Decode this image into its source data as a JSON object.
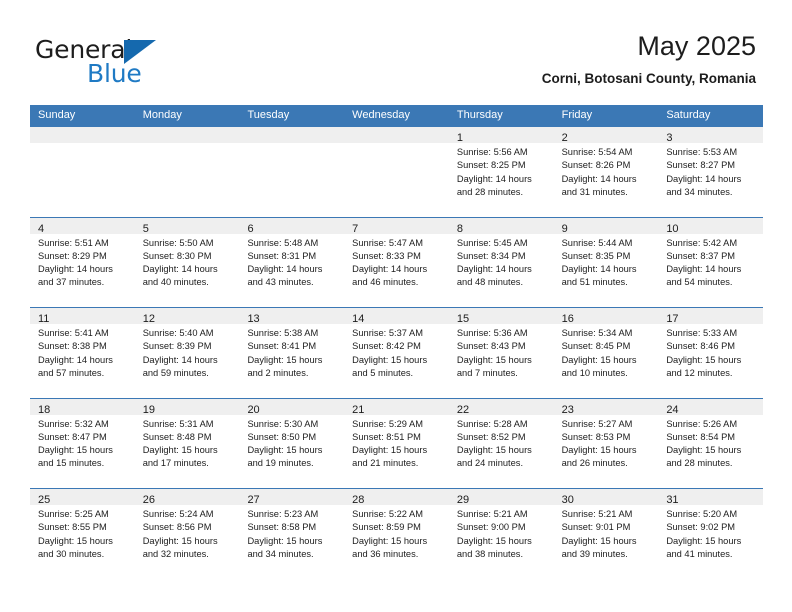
{
  "brand": {
    "name_part1": "General",
    "name_part2": "Blue",
    "accent_color": "#1f7ac4",
    "triangle_color": "#1569ae"
  },
  "header": {
    "month_title": "May 2025",
    "location": "Corni, Botosani County, Romania"
  },
  "calendar": {
    "header_bg": "#3b78b5",
    "weekdays": [
      "Sunday",
      "Monday",
      "Tuesday",
      "Wednesday",
      "Thursday",
      "Friday",
      "Saturday"
    ],
    "weeks": [
      [
        {
          "day": "",
          "lines": []
        },
        {
          "day": "",
          "lines": []
        },
        {
          "day": "",
          "lines": []
        },
        {
          "day": "",
          "lines": []
        },
        {
          "day": "1",
          "lines": [
            "Sunrise: 5:56 AM",
            "Sunset: 8:25 PM",
            "Daylight: 14 hours",
            "and 28 minutes."
          ]
        },
        {
          "day": "2",
          "lines": [
            "Sunrise: 5:54 AM",
            "Sunset: 8:26 PM",
            "Daylight: 14 hours",
            "and 31 minutes."
          ]
        },
        {
          "day": "3",
          "lines": [
            "Sunrise: 5:53 AM",
            "Sunset: 8:27 PM",
            "Daylight: 14 hours",
            "and 34 minutes."
          ]
        }
      ],
      [
        {
          "day": "4",
          "lines": [
            "Sunrise: 5:51 AM",
            "Sunset: 8:29 PM",
            "Daylight: 14 hours",
            "and 37 minutes."
          ]
        },
        {
          "day": "5",
          "lines": [
            "Sunrise: 5:50 AM",
            "Sunset: 8:30 PM",
            "Daylight: 14 hours",
            "and 40 minutes."
          ]
        },
        {
          "day": "6",
          "lines": [
            "Sunrise: 5:48 AM",
            "Sunset: 8:31 PM",
            "Daylight: 14 hours",
            "and 43 minutes."
          ]
        },
        {
          "day": "7",
          "lines": [
            "Sunrise: 5:47 AM",
            "Sunset: 8:33 PM",
            "Daylight: 14 hours",
            "and 46 minutes."
          ]
        },
        {
          "day": "8",
          "lines": [
            "Sunrise: 5:45 AM",
            "Sunset: 8:34 PM",
            "Daylight: 14 hours",
            "and 48 minutes."
          ]
        },
        {
          "day": "9",
          "lines": [
            "Sunrise: 5:44 AM",
            "Sunset: 8:35 PM",
            "Daylight: 14 hours",
            "and 51 minutes."
          ]
        },
        {
          "day": "10",
          "lines": [
            "Sunrise: 5:42 AM",
            "Sunset: 8:37 PM",
            "Daylight: 14 hours",
            "and 54 minutes."
          ]
        }
      ],
      [
        {
          "day": "11",
          "lines": [
            "Sunrise: 5:41 AM",
            "Sunset: 8:38 PM",
            "Daylight: 14 hours",
            "and 57 minutes."
          ]
        },
        {
          "day": "12",
          "lines": [
            "Sunrise: 5:40 AM",
            "Sunset: 8:39 PM",
            "Daylight: 14 hours",
            "and 59 minutes."
          ]
        },
        {
          "day": "13",
          "lines": [
            "Sunrise: 5:38 AM",
            "Sunset: 8:41 PM",
            "Daylight: 15 hours",
            "and 2 minutes."
          ]
        },
        {
          "day": "14",
          "lines": [
            "Sunrise: 5:37 AM",
            "Sunset: 8:42 PM",
            "Daylight: 15 hours",
            "and 5 minutes."
          ]
        },
        {
          "day": "15",
          "lines": [
            "Sunrise: 5:36 AM",
            "Sunset: 8:43 PM",
            "Daylight: 15 hours",
            "and 7 minutes."
          ]
        },
        {
          "day": "16",
          "lines": [
            "Sunrise: 5:34 AM",
            "Sunset: 8:45 PM",
            "Daylight: 15 hours",
            "and 10 minutes."
          ]
        },
        {
          "day": "17",
          "lines": [
            "Sunrise: 5:33 AM",
            "Sunset: 8:46 PM",
            "Daylight: 15 hours",
            "and 12 minutes."
          ]
        }
      ],
      [
        {
          "day": "18",
          "lines": [
            "Sunrise: 5:32 AM",
            "Sunset: 8:47 PM",
            "Daylight: 15 hours",
            "and 15 minutes."
          ]
        },
        {
          "day": "19",
          "lines": [
            "Sunrise: 5:31 AM",
            "Sunset: 8:48 PM",
            "Daylight: 15 hours",
            "and 17 minutes."
          ]
        },
        {
          "day": "20",
          "lines": [
            "Sunrise: 5:30 AM",
            "Sunset: 8:50 PM",
            "Daylight: 15 hours",
            "and 19 minutes."
          ]
        },
        {
          "day": "21",
          "lines": [
            "Sunrise: 5:29 AM",
            "Sunset: 8:51 PM",
            "Daylight: 15 hours",
            "and 21 minutes."
          ]
        },
        {
          "day": "22",
          "lines": [
            "Sunrise: 5:28 AM",
            "Sunset: 8:52 PM",
            "Daylight: 15 hours",
            "and 24 minutes."
          ]
        },
        {
          "day": "23",
          "lines": [
            "Sunrise: 5:27 AM",
            "Sunset: 8:53 PM",
            "Daylight: 15 hours",
            "and 26 minutes."
          ]
        },
        {
          "day": "24",
          "lines": [
            "Sunrise: 5:26 AM",
            "Sunset: 8:54 PM",
            "Daylight: 15 hours",
            "and 28 minutes."
          ]
        }
      ],
      [
        {
          "day": "25",
          "lines": [
            "Sunrise: 5:25 AM",
            "Sunset: 8:55 PM",
            "Daylight: 15 hours",
            "and 30 minutes."
          ]
        },
        {
          "day": "26",
          "lines": [
            "Sunrise: 5:24 AM",
            "Sunset: 8:56 PM",
            "Daylight: 15 hours",
            "and 32 minutes."
          ]
        },
        {
          "day": "27",
          "lines": [
            "Sunrise: 5:23 AM",
            "Sunset: 8:58 PM",
            "Daylight: 15 hours",
            "and 34 minutes."
          ]
        },
        {
          "day": "28",
          "lines": [
            "Sunrise: 5:22 AM",
            "Sunset: 8:59 PM",
            "Daylight: 15 hours",
            "and 36 minutes."
          ]
        },
        {
          "day": "29",
          "lines": [
            "Sunrise: 5:21 AM",
            "Sunset: 9:00 PM",
            "Daylight: 15 hours",
            "and 38 minutes."
          ]
        },
        {
          "day": "30",
          "lines": [
            "Sunrise: 5:21 AM",
            "Sunset: 9:01 PM",
            "Daylight: 15 hours",
            "and 39 minutes."
          ]
        },
        {
          "day": "31",
          "lines": [
            "Sunrise: 5:20 AM",
            "Sunset: 9:02 PM",
            "Daylight: 15 hours",
            "and 41 minutes."
          ]
        }
      ]
    ]
  }
}
